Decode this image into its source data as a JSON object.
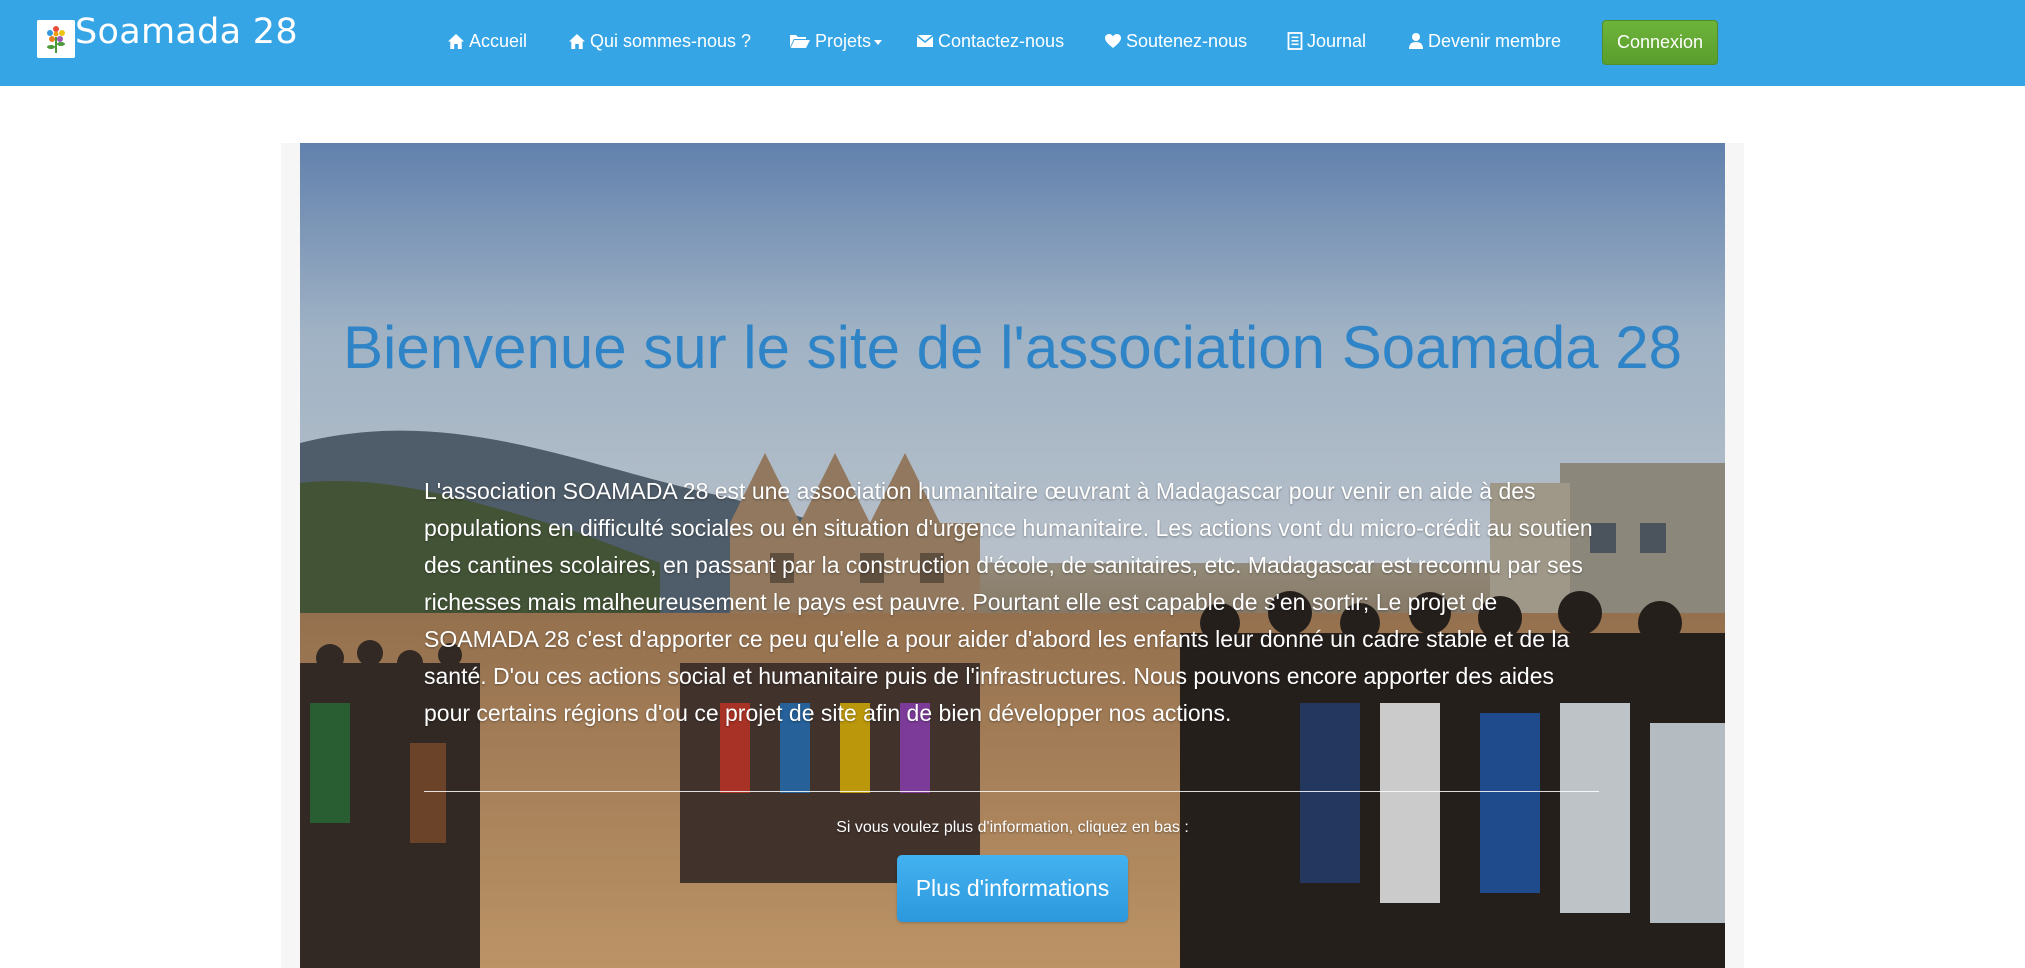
{
  "brand": {
    "name": "Soamada 28",
    "logo_icon": "flower-logo-icon"
  },
  "nav": {
    "items": [
      {
        "label": "Accueil",
        "icon": "home-icon"
      },
      {
        "label": "Qui sommes-nous ?",
        "icon": "home-icon"
      },
      {
        "label": "Projets",
        "icon": "folder-open-icon",
        "dropdown": true
      },
      {
        "label": "Contactez-nous",
        "icon": "envelope-icon"
      },
      {
        "label": "Soutenez-nous",
        "icon": "heart-icon"
      },
      {
        "label": "Journal",
        "icon": "book-icon"
      },
      {
        "label": "Devenir membre",
        "icon": "user-icon"
      }
    ],
    "login_label": "Connexion"
  },
  "hero": {
    "title": "Bienvenue sur le site de l'association Soamada 28",
    "text": "L'association SOAMADA 28 est une association humanitaire œuvrant à Madagascar pour venir en aide à des populations en difficulté sociales ou en situation d'urgence humanitaire. Les actions vont du micro-crédit au soutien des cantines scolaires, en passant par la construction d'école, de sanitaires, etc. Madagascar est reconnu par ses richesses mais malheureusement le pays est pauvre. Pourtant elle est capable de s'en sortir; Le projet de SOAMADA 28 c'est d'apporter ce peu qu'elle a pour aider d'abord les enfants leur donné un cadre stable et de la santé. D'ou ces actions social et humanitaire puis de l'infrastructures. Nous pouvons encore apporter des aides pour certains régions d'ou ce projet de site afin de bien développer nos actions.",
    "note": "Si vous voulez plus d'information, cliquez en bas :",
    "button_label": "Plus d'informations"
  },
  "colors": {
    "navbar": "#35a5e6",
    "login_button": "#5fa732",
    "title": "#2e84c6",
    "primary_button": "#35a5e6"
  }
}
